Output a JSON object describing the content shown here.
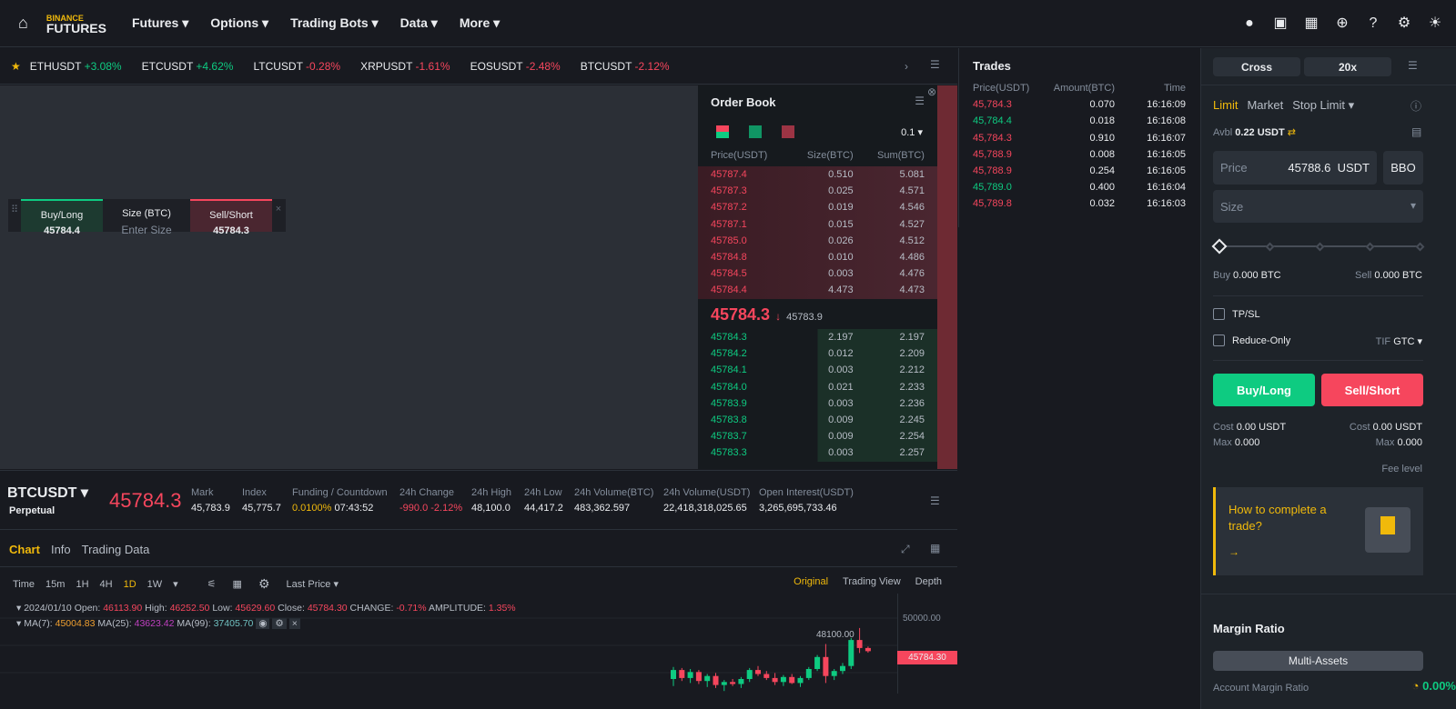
{
  "nav": {
    "logo_top": "BINANCE",
    "logo_bottom": "FUTURES",
    "menus": [
      "Futures",
      "Options",
      "Trading Bots",
      "Data",
      "More"
    ]
  },
  "ticker": [
    {
      "s": "ETHUSDT",
      "c": "+3.08%",
      "up": true
    },
    {
      "s": "ETCUSDT",
      "c": "+4.62%",
      "up": true
    },
    {
      "s": "LTCUSDT",
      "c": "-0.28%",
      "up": false
    },
    {
      "s": "XRPUSDT",
      "c": "-1.61%",
      "up": false
    },
    {
      "s": "EOSUSDT",
      "c": "-2.48%",
      "up": false
    },
    {
      "s": "BTCUSDT",
      "c": "-2.12%",
      "up": false
    }
  ],
  "quick": {
    "buy_label": "Buy/Long",
    "buy_price": "45784.4",
    "size_label": "Size (BTC)",
    "size_placeholder": "Enter Size",
    "sell_label": "Sell/Short",
    "sell_price": "45784.3"
  },
  "orderbook": {
    "title": "Order Book",
    "tick": "0.1",
    "headers": [
      "Price(USDT)",
      "Size(BTC)",
      "Sum(BTC)"
    ],
    "asks": [
      [
        "45787.4",
        "0.510",
        "5.081"
      ],
      [
        "45787.3",
        "0.025",
        "4.571"
      ],
      [
        "45787.2",
        "0.019",
        "4.546"
      ],
      [
        "45787.1",
        "0.015",
        "4.527"
      ],
      [
        "45785.0",
        "0.026",
        "4.512"
      ],
      [
        "45784.8",
        "0.010",
        "4.486"
      ],
      [
        "45784.5",
        "0.003",
        "4.476"
      ],
      [
        "45784.4",
        "4.473",
        "4.473"
      ]
    ],
    "last": "45784.3",
    "mark": "45783.9",
    "bids": [
      [
        "45784.3",
        "2.197",
        "2.197"
      ],
      [
        "45784.2",
        "0.012",
        "2.209"
      ],
      [
        "45784.1",
        "0.003",
        "2.212"
      ],
      [
        "45784.0",
        "0.021",
        "2.233"
      ],
      [
        "45783.9",
        "0.003",
        "2.236"
      ],
      [
        "45783.8",
        "0.009",
        "2.245"
      ],
      [
        "45783.7",
        "0.009",
        "2.254"
      ],
      [
        "45783.3",
        "0.003",
        "2.257"
      ]
    ]
  },
  "trades": {
    "title": "Trades",
    "headers": [
      "Price(USDT)",
      "Amount(BTC)",
      "Time"
    ],
    "rows": [
      [
        "45,784.3",
        "0.070",
        "16:16:09",
        "r"
      ],
      [
        "45,784.4",
        "0.018",
        "16:16:08",
        "g"
      ],
      [
        "45,784.3",
        "0.910",
        "16:16:07",
        "r"
      ],
      [
        "45,788.9",
        "0.008",
        "16:16:05",
        "r"
      ],
      [
        "45,788.9",
        "0.254",
        "16:16:05",
        "r"
      ],
      [
        "45,789.0",
        "0.400",
        "16:16:04",
        "g"
      ],
      [
        "45,789.8",
        "0.032",
        "16:16:03",
        "r"
      ]
    ]
  },
  "symbol": {
    "name": "BTCUSDT",
    "type": "Perpetual",
    "price": "45784.3",
    "stats": [
      {
        "l": "Mark",
        "v": "45,783.9"
      },
      {
        "l": "Index",
        "v": "45,775.7"
      },
      {
        "l": "Funding / Countdown",
        "v": "0.0100%",
        "v2": "07:43:52"
      },
      {
        "l": "24h Change",
        "v": "-990.0 -2.12%"
      },
      {
        "l": "24h High",
        "v": "48,100.0"
      },
      {
        "l": "24h Low",
        "v": "44,417.2"
      },
      {
        "l": "24h Volume(BTC)",
        "v": "483,362.597"
      },
      {
        "l": "24h Volume(USDT)",
        "v": "22,418,318,025.65"
      },
      {
        "l": "Open Interest(USDT)",
        "v": "3,265,695,733.46"
      }
    ]
  },
  "chart": {
    "tabs": [
      "Chart",
      "Info",
      "Trading Data"
    ],
    "intervals": [
      "Time",
      "15m",
      "1H",
      "4H",
      "1D",
      "1W"
    ],
    "price_type": "Last Price",
    "views": [
      "Original",
      "Trading View",
      "Depth"
    ],
    "ohlc": {
      "date": "2024/01/10",
      "open_l": "Open:",
      "open": "46113.90",
      "high_l": "High:",
      "high": "46252.50",
      "low_l": "Low:",
      "low": "45629.60",
      "close_l": "Close:",
      "close": "45784.30",
      "change_l": "CHANGE:",
      "change": "-0.71%",
      "amp_l": "AMPLITUDE:",
      "amp": "1.35%"
    },
    "ma": {
      "ma7_l": "MA(7):",
      "ma7": "45004.83",
      "ma25_l": "MA(25):",
      "ma25": "43623.42",
      "ma99_l": "MA(99):",
      "ma99": "37405.70"
    },
    "axis_label": "50000.00",
    "high_marker": "48100.00",
    "last_marker": "45784.30"
  },
  "chart_data": {
    "type": "candlestick",
    "ylim": [
      42000,
      52000
    ],
    "candles": [
      [
        43000,
        44200,
        42300,
        43900
      ],
      [
        43900,
        44100,
        42800,
        43100
      ],
      [
        43100,
        44000,
        42600,
        43700
      ],
      [
        43700,
        43900,
        42500,
        42800
      ],
      [
        42800,
        43500,
        42200,
        43300
      ],
      [
        43300,
        43600,
        42100,
        42400
      ],
      [
        42400,
        42900,
        41800,
        42700
      ],
      [
        42700,
        43000,
        42300,
        42500
      ],
      [
        42500,
        43200,
        42100,
        43000
      ],
      [
        43000,
        44100,
        42700,
        43900
      ],
      [
        43900,
        44300,
        43300,
        43500
      ],
      [
        43500,
        43800,
        42900,
        43100
      ],
      [
        43100,
        43600,
        42400,
        42700
      ],
      [
        42700,
        43400,
        42300,
        43200
      ],
      [
        43200,
        43500,
        42500,
        42600
      ],
      [
        42600,
        43300,
        42200,
        43100
      ],
      [
        43100,
        44200,
        42900,
        44000
      ],
      [
        44000,
        45400,
        43800,
        45200
      ],
      [
        45200,
        46500,
        42600,
        43300
      ],
      [
        43300,
        44000,
        42900,
        43800
      ],
      [
        43800,
        44600,
        43500,
        44300
      ],
      [
        44300,
        47100,
        44000,
        46900
      ],
      [
        46900,
        48100,
        45600,
        46100
      ],
      [
        46100,
        46250,
        45630,
        45784
      ]
    ]
  },
  "order": {
    "margin_mode": "Cross",
    "leverage": "20x",
    "types": [
      "Limit",
      "Market",
      "Stop Limit"
    ],
    "avbl_label": "Avbl",
    "avbl": "0.22 USDT",
    "price_label": "Price",
    "price_value": "45788.6",
    "price_unit": "USDT",
    "bbo": "BBO",
    "size_label": "Size",
    "buy_label": "Buy",
    "buy_val": "0.000 BTC",
    "sell_label": "Sell",
    "sell_val": "0.000 BTC",
    "tpsl": "TP/SL",
    "reduce": "Reduce-Only",
    "tif_label": "TIF",
    "tif": "GTC",
    "buy_btn": "Buy/Long",
    "sell_btn": "Sell/Short",
    "cost_label": "Cost",
    "buy_cost": "0.00 USDT",
    "sell_cost": "0.00 USDT",
    "max_label": "Max",
    "buy_max": "0.000",
    "sell_max": "0.000",
    "fee": "Fee level",
    "promo": "How to complete a trade?",
    "promo_arrow": "→"
  },
  "margin": {
    "title": "Margin Ratio",
    "mode": "Multi-Assets",
    "account_label": "Account Margin Ratio",
    "ratio": "0.00%"
  },
  "colors": {
    "green": "#0ecb81",
    "red": "#f6465d",
    "yellow": "#f0b90b"
  }
}
